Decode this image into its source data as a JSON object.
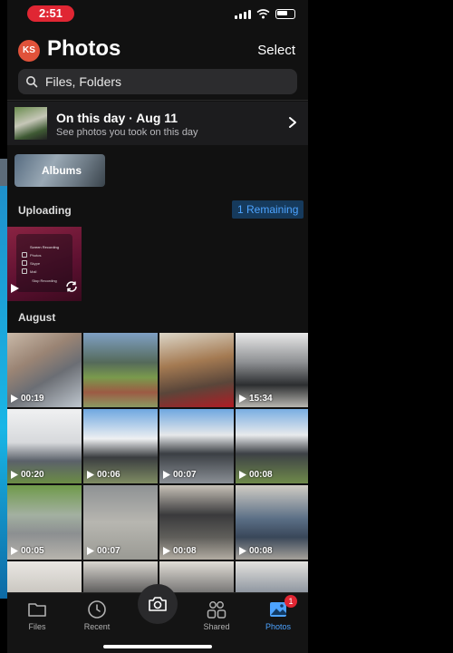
{
  "status_bar": {
    "time": "2:51"
  },
  "header": {
    "avatar_initials": "KS",
    "title": "Photos",
    "select_label": "Select"
  },
  "search": {
    "placeholder": "Files, Folders"
  },
  "on_this_day": {
    "title": "On this day · Aug 11",
    "subtitle": "See photos you took on this day"
  },
  "albums": {
    "label": "Albums"
  },
  "uploading": {
    "label": "Uploading",
    "remaining": "1 Remaining",
    "thumb_card": {
      "title": "Screen Recording",
      "rows": [
        "Photos",
        "Skype",
        "Mail"
      ],
      "stop": "Stop Recording"
    }
  },
  "august": {
    "label": "August",
    "items": [
      {
        "duration": "00:19",
        "kind": "video",
        "bg": "linear-gradient(150deg,#c9b9a8 0%,#9a8474 35%,#6b6e74 60%,#bfc7cf 100%)"
      },
      {
        "duration": "",
        "kind": "photo",
        "bg": "linear-gradient(180deg,#7fa0c4 0%,#556a5a 40%,#7a9a4d 60%,#9c5b44 80%,#8b9a62 100%)"
      },
      {
        "duration": "",
        "kind": "photo",
        "bg": "linear-gradient(170deg,#dcd6c8 0%,#a47a52 40%,#5a463a 70%,#b01c24 100%)"
      },
      {
        "duration": "15:34",
        "kind": "video",
        "bg": "linear-gradient(180deg,#e8e8e8 0%,#8d8f92 40%,#2c2e30 70%,#b8b6b0 100%)"
      },
      {
        "duration": "00:20",
        "kind": "video",
        "bg": "linear-gradient(180deg,#f0f1f2 0%,#d7d9dc 45%,#5b616a 70%,#6b8c45 100%)"
      },
      {
        "duration": "00:06",
        "kind": "video",
        "bg": "linear-gradient(180deg,#6ea7e0 0%,#eef0f2 40%,#3a3d40 65%,#7f8c63 100%)"
      },
      {
        "duration": "00:07",
        "kind": "video",
        "bg": "linear-gradient(180deg,#6ea7e0 0%,#e6e8ea 35%,#3b3f44 60%,#8a8f95 100%)"
      },
      {
        "duration": "00:08",
        "kind": "video",
        "bg": "linear-gradient(180deg,#79aee2 0%,#e8eaec 35%,#3d4146 60%,#6f8a4a 100%)"
      },
      {
        "duration": "00:05",
        "kind": "video",
        "bg": "linear-gradient(180deg,#6f9a4a 0%,#a3b0a1 40%,#8c8f91 65%,#b7b4ad 100%)"
      },
      {
        "duration": "00:07",
        "kind": "video",
        "bg": "linear-gradient(180deg,#8e9294 0%,#b7b6b0 50%,#9a9a94 100%)"
      },
      {
        "duration": "00:08",
        "kind": "video",
        "bg": "linear-gradient(180deg,#c7c1b7 0%,#3a3a3c 40%,#5f5e5a 70%,#b2aca2 100%)"
      },
      {
        "duration": "00:08",
        "kind": "video",
        "bg": "linear-gradient(180deg,#d0ccc4 0%,#5b6f86 45%,#394759 70%,#a5a19a 100%)"
      },
      {
        "duration": "",
        "kind": "photo",
        "bg": "linear-gradient(180deg,#e9e7e3 0%,#bdb9b2 60%,#8b8780 100%)"
      },
      {
        "duration": "",
        "kind": "photo",
        "bg": "linear-gradient(180deg,#d9d6d0 0%,#2a2a2c 60%,#6e6b66 100%)"
      },
      {
        "duration": "",
        "kind": "photo",
        "bg": "linear-gradient(180deg,#e1ddd6 0%,#4a4a4c 60%,#6d6a65 100%)"
      },
      {
        "duration": "",
        "kind": "photo",
        "bg": "linear-gradient(180deg,#e4e2de 0%,#6a7686 60%,#8c8882 100%)"
      }
    ]
  },
  "tabbar": {
    "tabs": [
      {
        "label": "Files",
        "icon": "folder-icon"
      },
      {
        "label": "Recent",
        "icon": "clock-icon"
      },
      {
        "label": "",
        "icon": "camera-icon"
      },
      {
        "label": "Shared",
        "icon": "people-icon"
      },
      {
        "label": "Photos",
        "icon": "photos-icon",
        "badge": "1"
      }
    ],
    "active_color": "#4da3ff"
  },
  "colors": {
    "accent": "#4da3ff",
    "badge": "#e02633",
    "status_pill": "#e02633"
  }
}
